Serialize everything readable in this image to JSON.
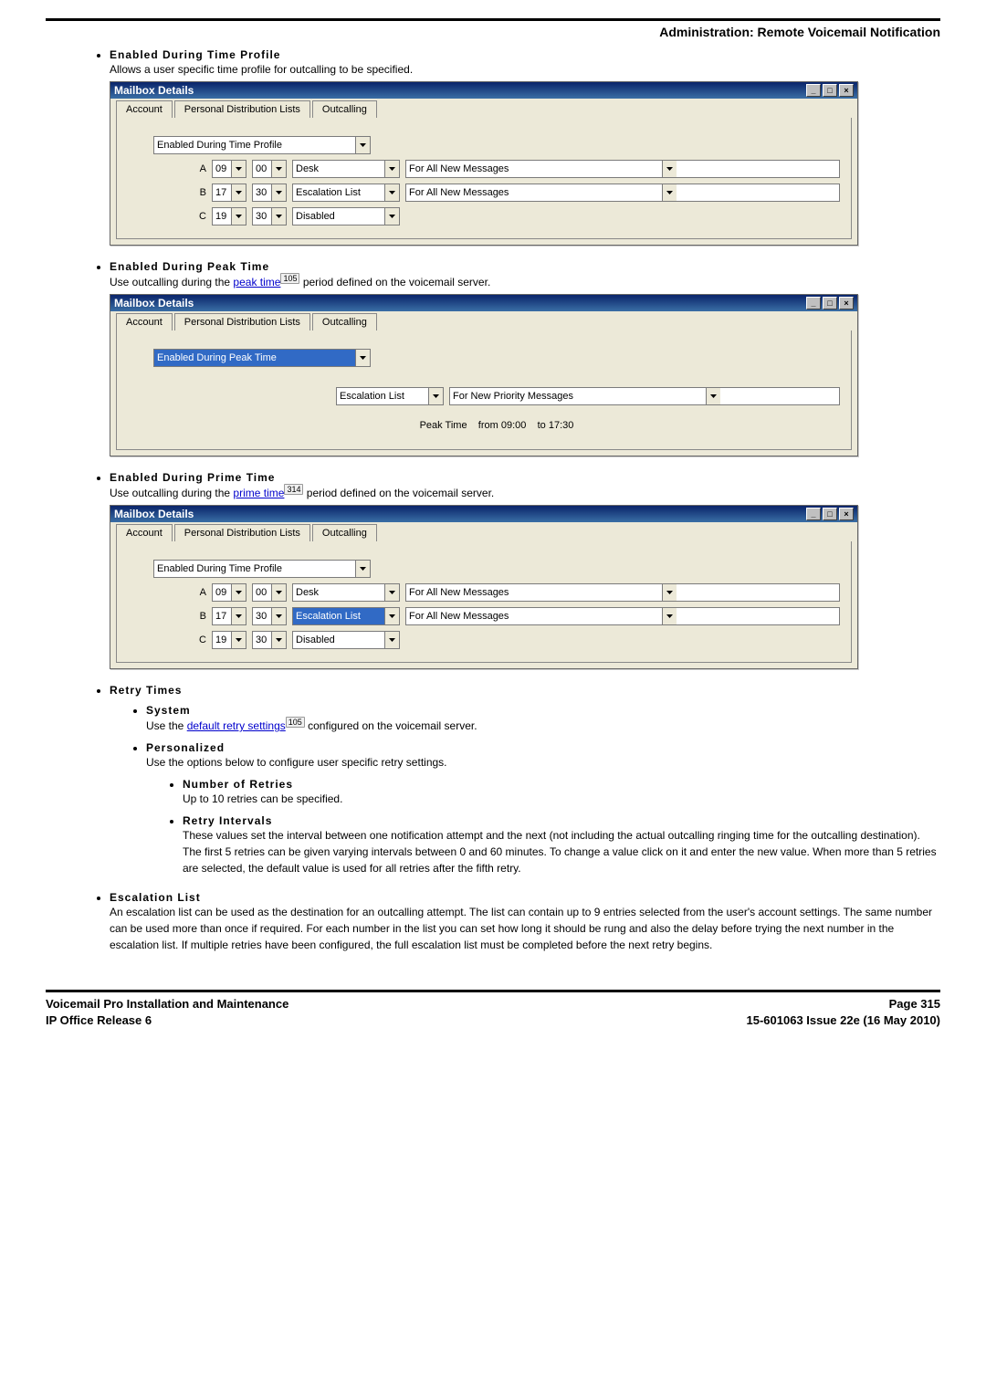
{
  "header": "Administration: Remote Voicemail Notification",
  "sections": {
    "timeProfile": {
      "title": "Enabled During Time Profile",
      "desc": "Allows a user specific time profile for outcalling to be specified."
    },
    "peakTime": {
      "title": "Enabled During Peak Time",
      "descPre": "Use outcalling during the ",
      "link": "peak time",
      "ref": "105",
      "descPost": " period defined on the voicemail server."
    },
    "primeTime": {
      "title": "Enabled During Prime Time",
      "descPre": "Use outcalling during the ",
      "link": "prime time",
      "ref": "314",
      "descPost": " period defined on the voicemail server."
    },
    "retry": {
      "title": "Retry Times",
      "system": {
        "title": "System",
        "descPre": "Use the ",
        "link": "default retry settings",
        "ref": "105",
        "descPost": " configured on the voicemail server."
      },
      "personalized": {
        "title": "Personalized",
        "desc": "Use the options below to configure user specific retry settings.",
        "numRetries": {
          "title": "Number of Retries",
          "desc": "Up to 10 retries can be specified."
        },
        "intervals": {
          "title": "Retry Intervals",
          "desc": "These values set the interval between one notification attempt and the next (not including the actual outcalling ringing time for the outcalling destination). The first 5 retries can be given varying intervals between 0 and 60 minutes. To change a value click on it and enter the new value. When more than 5 retries are selected, the default value is used for all retries after the fifth retry."
        }
      }
    },
    "escalation": {
      "title": "Escalation List",
      "desc": "An escalation list can be used as the destination for an outcalling attempt. The list can contain up to 9 entries selected from the user's account settings. The same number can be used more than once if required. For each number in the list you can set how long it should be rung and also the delay before trying the next number in the escalation list. If multiple retries have been configured, the full escalation list must be completed before the next retry begins."
    }
  },
  "win": {
    "title": "Mailbox Details",
    "tabs": {
      "account": "Account",
      "pdl": "Personal Distribution Lists",
      "outcalling": "Outcalling"
    },
    "modeTimeProfile": "Enabled During Time Profile",
    "modePeakTime": "Enabled During Peak Time",
    "rows1": {
      "A": {
        "l": "A",
        "h": "09",
        "m": "00",
        "dest": "Desk",
        "msg": "For All New Messages"
      },
      "B": {
        "l": "B",
        "h": "17",
        "m": "30",
        "dest": "Escalation List",
        "msg": "For All New Messages"
      },
      "C": {
        "l": "C",
        "h": "19",
        "m": "30",
        "dest": "Disabled"
      }
    },
    "peak": {
      "dest": "Escalation List",
      "msg": "For New Priority Messages",
      "label": "Peak Time",
      "from": "from 09:00",
      "to": "to 17:30"
    },
    "rows3": {
      "A": {
        "l": "A",
        "h": "09",
        "m": "00",
        "dest": "Desk",
        "msg": "For All New Messages"
      },
      "B": {
        "l": "B",
        "h": "17",
        "m": "30",
        "dest": "Escalation List",
        "msg": "For All New Messages"
      },
      "C": {
        "l": "C",
        "h": "19",
        "m": "30",
        "dest": "Disabled"
      }
    }
  },
  "footer": {
    "leftTop": "Voicemail Pro Installation and Maintenance",
    "leftBot": "IP Office Release 6",
    "rightTop": "Page 315",
    "rightBot": "15-601063 Issue 22e (16 May 2010)"
  }
}
